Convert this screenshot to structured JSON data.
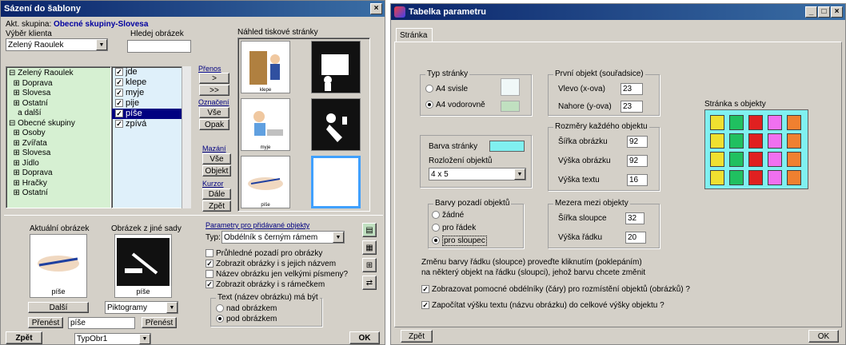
{
  "left": {
    "title": "Sázení do šablony",
    "close": "×",
    "group_label": "Akt. skupina:",
    "group_value": "Obecné skupiny-Slovesa",
    "client_label": "Výběr klienta",
    "client_value": "Zelený Raoulek",
    "search_label": "Hledej obrázek",
    "tree": [
      "⊟ Zelený Raoulek",
      "  ⊞ Doprava",
      "  ⊞ Slovesa",
      "  ⊞ Ostatní",
      "    a další",
      "⊟ Obecné skupiny",
      "  ⊞ Osoby",
      "  ⊞ Zvířata",
      "  ⊞ Slovesa",
      "  ⊞ Jídlo",
      "  ⊞ Doprava",
      "  ⊞ Hračky",
      "  ⊞ Ostatní"
    ],
    "words": [
      "jde",
      "klepe",
      "myje",
      "pije",
      "píše",
      "zpívá"
    ],
    "preview_title": "Náhled tiskové stránky",
    "prenos": "Přenos",
    "btn_next": ">",
    "btn_all_next": ">>",
    "oznaceni": "Označení",
    "btn_all1": "Vše",
    "btn_opak": "Opak",
    "mazani": "Mazání",
    "btn_all2": "Vše",
    "btn_objekt": "Objekt",
    "kurzor": "Kurzor",
    "btn_dale": "Dále",
    "btn_zpet_small": "Zpět",
    "current_img_label": "Aktuální obrázek",
    "other_img_label": "Obrázek z jiné sady",
    "current_caption": "píše",
    "other_caption": "píše",
    "btn_dalsi": "Další",
    "set_value": "Piktogramy",
    "btn_prenest1": "Přenést",
    "word_field": "píše",
    "btn_prenest2": "Přenést",
    "params_link": "Parametry pro přidávané objekty",
    "type_label": "Typ:",
    "type_value": "Obdélník s černým rámem",
    "checks": [
      {
        "label": "Průhledné pozadí pro obrázky",
        "checked": ""
      },
      {
        "label": "Zobrazit obrázky i s jejich názvem",
        "checked": "✓"
      },
      {
        "label": "Název obrázku jen velkými písmeny?",
        "checked": ""
      },
      {
        "label": "Zobrazit obrázky i s rámečkem",
        "checked": "✓"
      }
    ],
    "text_group": "Text (název obrázku) má být",
    "radio_above": "nad obrázkem",
    "radio_below": "pod obrázkem",
    "btn_zpet": "Zpět",
    "type_obr": "TypObr1",
    "btn_ok": "OK"
  },
  "right": {
    "title": "Tabelka parametru",
    "tab": "Stránka",
    "page_type": "Typ stránky",
    "a4_portrait": "A4 svisle",
    "a4_landscape": "A4 vodorovně",
    "first_obj": "První objekt (souřadsice)",
    "left_label": "Vlevo (x-ova)",
    "left_val": "23",
    "top_label": "Nahore (y-ova)",
    "top_val": "23",
    "sizes": "Rozměry každého objektu",
    "w_img": "Šířka obrázku",
    "w_img_val": "92",
    "h_img": "Výška obrázku",
    "h_img_val": "92",
    "h_text": "Výška textu",
    "h_text_val": "16",
    "page_color": "Barva stránky",
    "layout_label": "Rozložení objektů",
    "layout_value": "4 x 5",
    "bg_colors": "Barvy pozadí objektů",
    "r_none": "žádné",
    "r_row": "pro řádek",
    "r_col": "pro sloupec",
    "gaps": "Mezera mezi objekty",
    "col_w": "Šířka sloupce",
    "col_w_val": "32",
    "row_h": "Výška řádku",
    "row_h_val": "20",
    "page_objs": "Stránka s objekty",
    "hint1": "Změnu barvy řádku (sloupce) proveďte kliknutím (poklepáním)",
    "hint2": "na některý objekt na řádku (sloupci), jehož barvu chcete změnit",
    "chk1": "Zobrazovat pomocné obdélníky (čáry) pro rozmístění objektů (obrázků) ?",
    "chk2": "Započítat výšku textu (názvu obrázku) do celkové výšky objektu ?",
    "btn_zpet": "Zpět",
    "btn_ok": "OK",
    "col_colors": [
      "#f0e030",
      "#20c060",
      "#e02020",
      "#f070f0",
      "#f08030"
    ],
    "page_color_hex": "#80f0f0"
  }
}
